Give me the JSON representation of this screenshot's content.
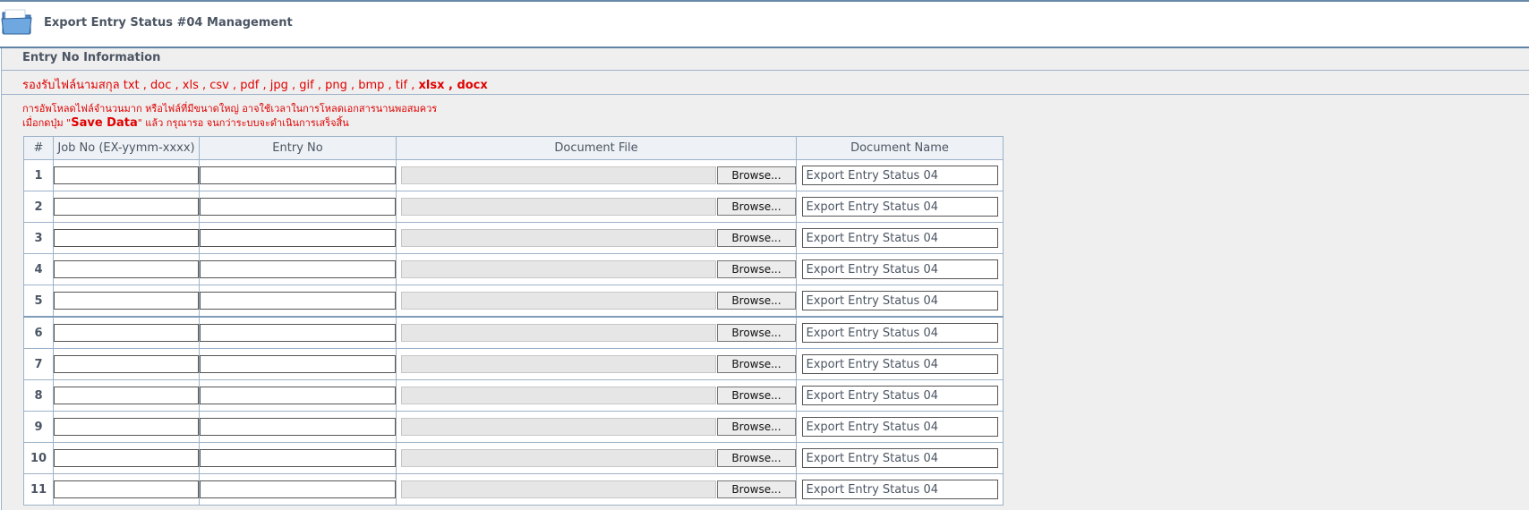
{
  "header": {
    "title": "Export Entry Status #04 Management",
    "icon": "folder-icon"
  },
  "section": {
    "title": "Entry No Information",
    "formats_prefix": "รองรับไฟล์นามสกุล txt , doc , xls , csv , pdf , jpg , gif , png , bmp , tif , ",
    "formats_bold": "xlsx , docx",
    "notice_line1": "การอัพโหลดไฟล์จำนวนมาก หรือไฟล์ที่มีขนาดใหญ่ อาจใช้เวลาในการโหลดเอกสารนานพอสมควร",
    "notice_line2_prefix": "เมื่อกดปุ่ม \"",
    "notice_line2_bold": "Save Data",
    "notice_line2_suffix": "\" แล้ว กรุณารอ จนกว่าระบบจะดำเนินการเสร็จสิ้น"
  },
  "table": {
    "columns": [
      "#",
      "Job No (EX-yymm-xxxx)",
      "Entry No",
      "Document File",
      "Document Name"
    ],
    "browse_label": "Browse...",
    "rows": [
      {
        "no": "1",
        "job_no": "",
        "entry_no": "",
        "doc_name": "Export Entry Status 04"
      },
      {
        "no": "2",
        "job_no": "",
        "entry_no": "",
        "doc_name": "Export Entry Status 04"
      },
      {
        "no": "3",
        "job_no": "",
        "entry_no": "",
        "doc_name": "Export Entry Status 04"
      },
      {
        "no": "4",
        "job_no": "",
        "entry_no": "",
        "doc_name": "Export Entry Status 04"
      },
      {
        "no": "5",
        "job_no": "",
        "entry_no": "",
        "doc_name": "Export Entry Status 04"
      },
      {
        "no": "6",
        "job_no": "",
        "entry_no": "",
        "doc_name": "Export Entry Status 04"
      },
      {
        "no": "7",
        "job_no": "",
        "entry_no": "",
        "doc_name": "Export Entry Status 04"
      },
      {
        "no": "8",
        "job_no": "",
        "entry_no": "",
        "doc_name": "Export Entry Status 04"
      },
      {
        "no": "9",
        "job_no": "",
        "entry_no": "",
        "doc_name": "Export Entry Status 04"
      },
      {
        "no": "10",
        "job_no": "",
        "entry_no": "",
        "doc_name": "Export Entry Status 04"
      },
      {
        "no": "11",
        "job_no": "",
        "entry_no": "",
        "doc_name": "Export Entry Status 04"
      }
    ]
  },
  "colors": {
    "accent_border": "#5f82a6",
    "notice_red": "#e00000",
    "panel_bg": "#efefef"
  }
}
